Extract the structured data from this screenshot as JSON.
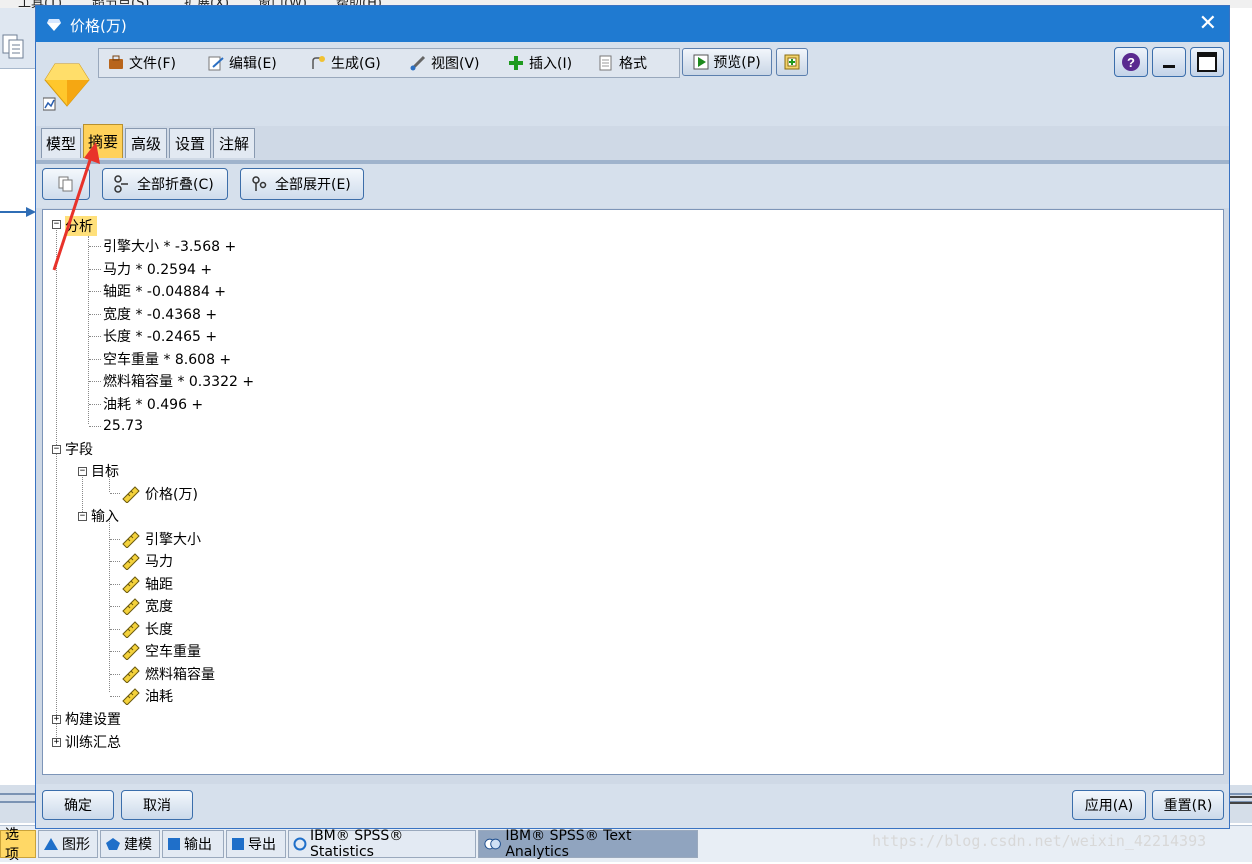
{
  "background": {
    "menu_items": [
      "工具(T)",
      "超节点(S)",
      "扩展(X)",
      "窗口(W)",
      "帮助(H)"
    ],
    "palette_tabs": [
      {
        "label": "选项",
        "selected": true
      },
      {
        "label": "图形"
      },
      {
        "label": "建模"
      },
      {
        "label": "输出"
      },
      {
        "label": "导出"
      },
      {
        "label": "IBM® SPSS® Statistics"
      },
      {
        "label": "IBM® SPSS® Text Analytics"
      }
    ],
    "watermark": "https://blog.csdn.net/weixin_42214393"
  },
  "dialog": {
    "title": "价格(万)",
    "close_glyph": "✕",
    "menus": [
      {
        "label": "文件(F)",
        "icon": "briefcase-icon"
      },
      {
        "label": "编辑(E)",
        "icon": "edit-icon"
      },
      {
        "label": "生成(G)",
        "icon": "generate-icon"
      },
      {
        "label": "视图(V)",
        "icon": "brush-icon"
      },
      {
        "label": "插入(I)",
        "icon": "plus-icon"
      },
      {
        "label": "格式",
        "icon": "page-icon"
      }
    ],
    "preview_label": "预览(P)",
    "tabs": [
      "模型",
      "摘要",
      "高级",
      "设置",
      "注解"
    ],
    "active_tab": "摘要",
    "collapse_all_label": "全部折叠(C)",
    "expand_all_label": "全部展开(E)",
    "tree": {
      "analysis": {
        "label": "分析",
        "terms": [
          "引擎大小 * -3.568 +",
          "马力 * 0.2594 +",
          "轴距 * -0.04884 +",
          "宽度 * -0.4368 +",
          "长度 * -0.2465 +",
          "空车重量 * 8.608 +",
          "燃料箱容量 * 0.3322 +",
          "油耗 * 0.496 +",
          "25.73"
        ]
      },
      "fields": {
        "label": "字段",
        "target_label": "目标",
        "target_field": "价格(万)",
        "input_label": "输入",
        "input_fields": [
          "引擎大小",
          "马力",
          "轴距",
          "宽度",
          "长度",
          "空车重量",
          "燃料箱容量",
          "油耗"
        ]
      },
      "build_settings_label": "构建设置",
      "training_summary_label": "训练汇总"
    },
    "ok_label": "确定",
    "cancel_label": "取消",
    "apply_label": "应用(A)",
    "reset_label": "重置(R)",
    "colors": {
      "titlebar": "#1f7ad1",
      "active_tab": "#ffd15a",
      "annotation_arrow": "#e8322a"
    }
  }
}
